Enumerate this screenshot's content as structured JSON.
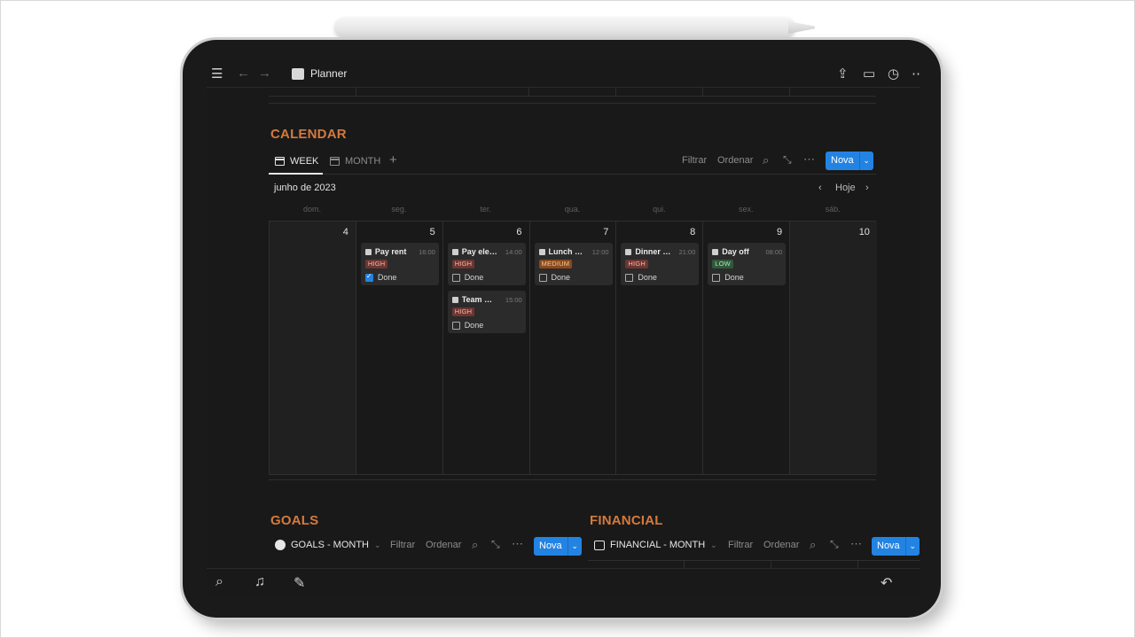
{
  "app": {
    "page_title": "Planner"
  },
  "calendar": {
    "title": "CALENDAR",
    "tabs": [
      {
        "label": "WEEK",
        "active": true
      },
      {
        "label": "MONTH",
        "active": false
      }
    ],
    "toolbar": {
      "filter": "Filtrar",
      "sort": "Ordenar",
      "new": "Nova"
    },
    "month_label": "junho de 2023",
    "today_label": "Hoje",
    "weekdays": [
      "dom.",
      "seg.",
      "ter.",
      "qua.",
      "qui.",
      "sex.",
      "sáb."
    ],
    "days": [
      {
        "num": "4",
        "weekend": true,
        "events": []
      },
      {
        "num": "5",
        "weekend": false,
        "events": [
          {
            "title": "Pay rent",
            "time": "16:00",
            "priority": "HIGH",
            "done_label": "Done",
            "done": true
          }
        ]
      },
      {
        "num": "6",
        "weekend": false,
        "events": [
          {
            "title": "Pay ele…",
            "time": "14:00",
            "priority": "HIGH",
            "done_label": "Done",
            "done": false
          },
          {
            "title": "Team …",
            "time": "15:00",
            "priority": "HIGH",
            "done_label": "Done",
            "done": false
          }
        ]
      },
      {
        "num": "7",
        "weekend": false,
        "events": [
          {
            "title": "Lunch …",
            "time": "12:00",
            "priority": "MEDIUM",
            "done_label": "Done",
            "done": false
          }
        ]
      },
      {
        "num": "8",
        "weekend": false,
        "events": [
          {
            "title": "Dinner …",
            "time": "21:00",
            "priority": "HIGH",
            "done_label": "Done",
            "done": false
          }
        ]
      },
      {
        "num": "9",
        "weekend": false,
        "events": [
          {
            "title": "Day off",
            "time": "08:00",
            "priority": "LOW",
            "done_label": "Done",
            "done": false
          }
        ]
      },
      {
        "num": "10",
        "weekend": true,
        "events": []
      }
    ]
  },
  "goals": {
    "title": "GOALS",
    "view": "GOALS - MONTH",
    "filter": "Filtrar",
    "sort": "Ordenar",
    "new": "Nova"
  },
  "financial": {
    "title": "FINANCIAL",
    "view": "FINANCIAL - MONTH",
    "filter": "Filtrar",
    "sort": "Ordenar",
    "new": "Nova"
  }
}
